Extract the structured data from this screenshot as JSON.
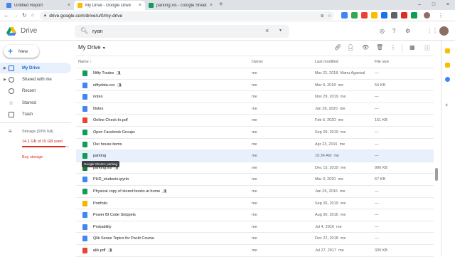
{
  "browser": {
    "tabs": [
      {
        "title": "Untitled Report",
        "active": false,
        "favicon_color": "#4285f4"
      },
      {
        "title": "My Drive - Google Drive",
        "active": true,
        "favicon_color": "#fbbc04"
      },
      {
        "title": "parking.xls - Google Sheets",
        "active": false,
        "favicon_color": "#0f9d58"
      }
    ],
    "close_glyph": "×",
    "new_tab": "+",
    "url": "drive.google.com/drive/u/0/my-drive",
    "window_controls": [
      "–",
      "□",
      "×"
    ]
  },
  "drive": {
    "app_name": "Drive",
    "search": {
      "value": "ryan"
    },
    "new_label": "New",
    "sidebar": [
      {
        "label": "My Drive",
        "selected": true,
        "icon": "my-drive-icon"
      },
      {
        "label": "Shared with me",
        "selected": false,
        "icon": "people-icon"
      },
      {
        "label": "Recent",
        "selected": false,
        "icon": "clock-icon"
      },
      {
        "label": "Starred",
        "selected": false,
        "icon": "star-icon"
      },
      {
        "label": "Trash",
        "selected": false,
        "icon": "trash-icon"
      }
    ],
    "storage": {
      "label": "Storage (93% full)",
      "used": "14.1 GB of 15 GB used",
      "fraction": 0.93,
      "buy": "Buy storage"
    },
    "breadcrumb": "My Drive",
    "columns": {
      "name": "Name",
      "owner": "Owner",
      "modified": "Last modified",
      "size": "File size"
    },
    "files": [
      {
        "name": "Nifty Trades",
        "type": "sheet",
        "shared": true,
        "owner": "me",
        "modified": "Mar 22, 2018",
        "modified_by": "Manu Agarwal",
        "size": "—"
      },
      {
        "name": "niftydata.csv",
        "type": "doc",
        "shared": true,
        "owner": "me",
        "modified": "Mar 9, 2018",
        "modified_by": "me",
        "size": "54 KB"
      },
      {
        "name": "notes",
        "type": "doc",
        "shared": false,
        "owner": "me",
        "modified": "Nov 29, 2019",
        "modified_by": "me",
        "size": "—"
      },
      {
        "name": "Notes",
        "type": "doc",
        "shared": false,
        "owner": "me",
        "modified": "Jan 28, 2020",
        "modified_by": "me",
        "size": "—"
      },
      {
        "name": "Online Check-In.pdf",
        "type": "pdf",
        "shared": false,
        "owner": "me",
        "modified": "Feb 6, 2020",
        "modified_by": "me",
        "size": "151 KB"
      },
      {
        "name": "Open Facebook Groups",
        "type": "sheet",
        "shared": false,
        "owner": "me",
        "modified": "Sep 29, 2019",
        "modified_by": "me",
        "size": "—"
      },
      {
        "name": "Our house items",
        "type": "sheet",
        "shared": false,
        "owner": "me",
        "modified": "Apr 23, 2016",
        "modified_by": "me",
        "size": "—"
      },
      {
        "name": "parking",
        "type": "sheet",
        "shared": false,
        "owner": "me",
        "modified": "10:34 AM",
        "modified_by": "me",
        "size": "—",
        "selected": true
      },
      {
        "name": "parking.xls",
        "type": "excel",
        "shared": true,
        "owner": "me",
        "modified": "Dec 15, 2019",
        "modified_by": "me",
        "size": "996 KB"
      },
      {
        "name": "PHD_students.ipynb",
        "type": "doc",
        "shared": false,
        "owner": "me",
        "modified": "Mar 3, 2020",
        "modified_by": "me",
        "size": "67 KB"
      },
      {
        "name": "Physical copy of stored books at home",
        "type": "sheet",
        "shared": true,
        "owner": "me",
        "modified": "Jan 26, 2016",
        "modified_by": "me",
        "size": "—"
      },
      {
        "name": "Portfolio",
        "type": "slides",
        "shared": false,
        "owner": "me",
        "modified": "Sep 26, 2019",
        "modified_by": "me",
        "size": "—"
      },
      {
        "name": "Power BI Code Snippets",
        "type": "doc",
        "shared": false,
        "owner": "me",
        "modified": "Aug 30, 2016",
        "modified_by": "me",
        "size": "—"
      },
      {
        "name": "Probability",
        "type": "doc",
        "shared": false,
        "owner": "me",
        "modified": "Jul 4, 2016",
        "modified_by": "me",
        "size": "—"
      },
      {
        "name": "Qlik Sense Topics for Packt Course",
        "type": "doc",
        "shared": false,
        "owner": "me",
        "modified": "Dec 22, 2018",
        "modified_by": "me",
        "size": "—"
      },
      {
        "name": "qlik.pdf",
        "type": "pdf",
        "shared": true,
        "owner": "me",
        "modified": "Jul 27, 2017",
        "modified_by": "me",
        "size": "330 KB"
      }
    ],
    "tooltip": "Google Sheets: parking"
  },
  "colors": {
    "sheet": "#0f9d58",
    "doc": "#4285f4",
    "pdf": "#ea4335",
    "excel": "#188038",
    "slides": "#f4b400"
  }
}
